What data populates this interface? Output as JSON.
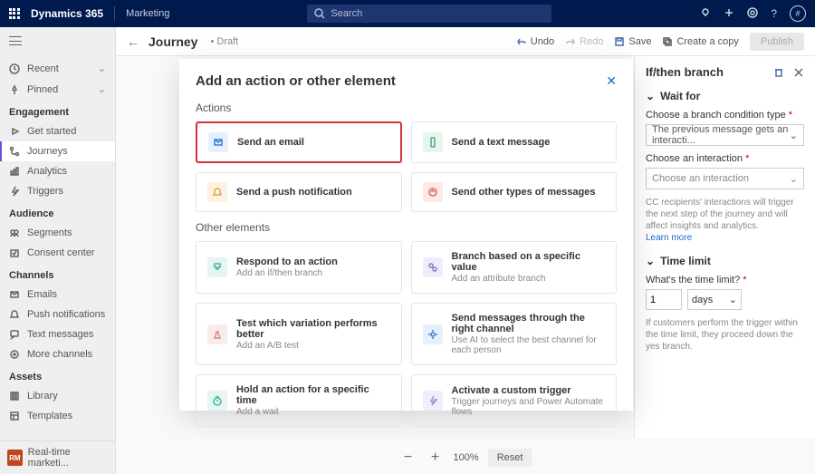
{
  "topbar": {
    "app": "Dynamics 365",
    "module": "Marketing",
    "search_placeholder": "Search"
  },
  "sidebar": {
    "recent": "Recent",
    "pinned": "Pinned",
    "engagement_heading": "Engagement",
    "get_started": "Get started",
    "journeys": "Journeys",
    "analytics": "Analytics",
    "triggers": "Triggers",
    "audience_heading": "Audience",
    "segments": "Segments",
    "consent": "Consent center",
    "channels_heading": "Channels",
    "emails": "Emails",
    "push": "Push notifications",
    "text": "Text messages",
    "more_channels": "More channels",
    "assets_heading": "Assets",
    "library": "Library",
    "templates": "Templates",
    "footer_badge": "RM",
    "footer_label": "Real-time marketi..."
  },
  "cmdbar": {
    "title": "Journey",
    "status": "Draft",
    "undo": "Undo",
    "redo": "Redo",
    "save": "Save",
    "copy": "Create a copy",
    "publish": "Publish"
  },
  "side_panel": {
    "title": "If/then branch",
    "wait_for": "Wait for",
    "cond_label": "Choose a branch condition type",
    "cond_value": "The previous message gets an interacti...",
    "interaction_label": "Choose an interaction",
    "interaction_placeholder": "Choose an interaction",
    "help": "CC recipients' interactions will trigger the next step of the journey and will affect insights and analytics.",
    "learn_more": "Learn more",
    "time_limit": "Time limit",
    "time_label": "What's the time limit?",
    "time_value": "1",
    "time_unit": "days",
    "time_help": "If customers perform the trigger within the time limit, they proceed down the yes branch."
  },
  "zoom": {
    "percent": "100%",
    "reset": "Reset"
  },
  "modal": {
    "title": "Add an action or other element",
    "actions_heading": "Actions",
    "other_heading": "Other elements",
    "tiles": {
      "email": "Send an email",
      "text": "Send a text message",
      "push": "Send a push notification",
      "other_msg": "Send other types of messages",
      "respond_t": "Respond to an action",
      "respond_s": "Add an if/then branch",
      "branch_t": "Branch based on a specific value",
      "branch_s": "Add an attribute branch",
      "test_t": "Test which variation performs better",
      "test_s": "Add an A/B test",
      "channel_t": "Send messages through the right channel",
      "channel_s": "Use AI to select the best channel for each person",
      "hold_t": "Hold an action for a specific time",
      "hold_s": "Add a wait",
      "trigger_t": "Activate a custom trigger",
      "trigger_s": "Trigger journeys and Power Automate flows"
    }
  }
}
